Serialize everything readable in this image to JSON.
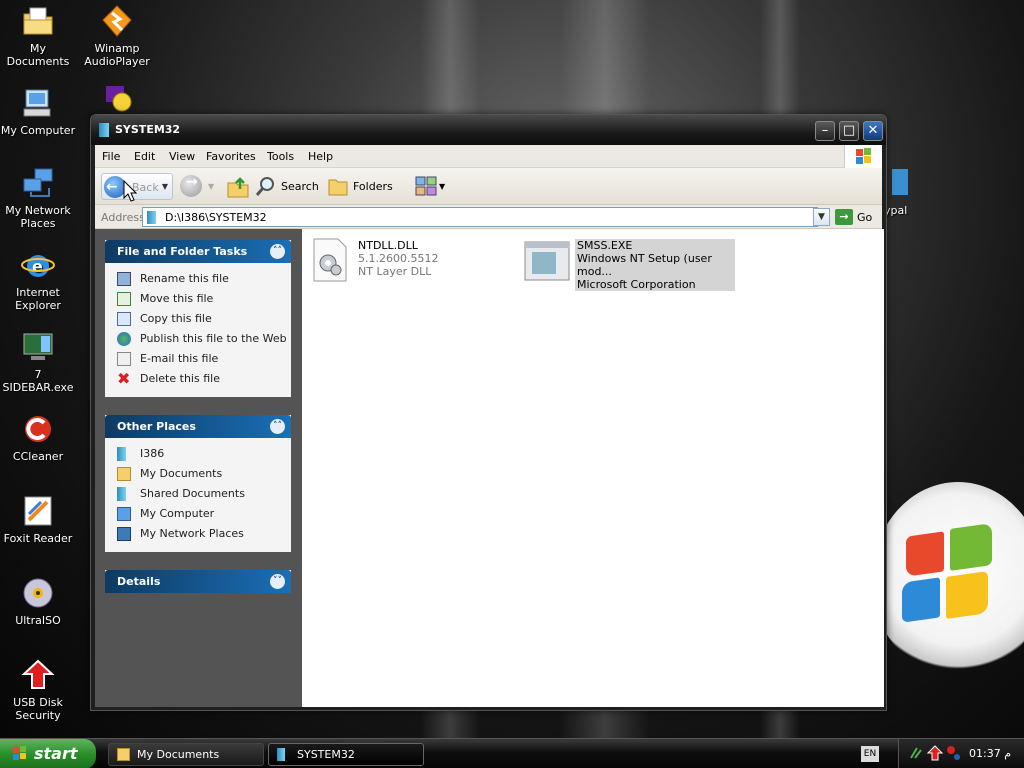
{
  "desktop": {
    "icons": [
      {
        "label": "My Documents",
        "icon": "my-documents-icon"
      },
      {
        "label": "Winamp AudioPlayer",
        "icon": "winamp-icon"
      },
      {
        "label": "My Computer",
        "icon": "my-computer-icon"
      },
      {
        "label": "My Network Places",
        "icon": "network-places-icon"
      },
      {
        "label": "Internet Explorer",
        "icon": "internet-explorer-icon"
      },
      {
        "label": "7 SIDEBAR.exe",
        "icon": "sidebar-icon"
      },
      {
        "label": "CCleaner",
        "icon": "ccleaner-icon"
      },
      {
        "label": "Foxit Reader",
        "icon": "foxit-icon"
      },
      {
        "label": "UltraISO",
        "icon": "ultraiso-icon"
      },
      {
        "label": "USB Disk Security",
        "icon": "usb-disk-security-icon"
      },
      {
        "label": "ypal",
        "icon": "partial-icon"
      }
    ]
  },
  "window": {
    "title": "SYSTEM32",
    "menu": [
      "File",
      "Edit",
      "View",
      "Favorites",
      "Tools",
      "Help"
    ],
    "toolbar": {
      "back": "Back",
      "search": "Search",
      "folders": "Folders"
    },
    "address": {
      "label": "Address",
      "path": "D:\\I386\\SYSTEM32",
      "go": "Go"
    }
  },
  "tasks_panel": {
    "title": "File and Folder Tasks",
    "items": [
      "Rename this file",
      "Move this file",
      "Copy this file",
      "Publish this file to the Web",
      "E-mail this file",
      "Delete this file"
    ]
  },
  "places_panel": {
    "title": "Other Places",
    "items": [
      "I386",
      "My Documents",
      "Shared Documents",
      "My Computer",
      "My Network Places"
    ]
  },
  "details_panel": {
    "title": "Details"
  },
  "files": [
    {
      "name": "NTDLL.DLL",
      "line2": "5.1.2600.5512",
      "line3": "NT Layer DLL",
      "selected": false
    },
    {
      "name": "SMSS.EXE",
      "line2": "Windows NT Setup (user mod...",
      "line3": "Microsoft Corporation",
      "selected": true
    }
  ],
  "taskbar": {
    "start": "start",
    "items": [
      "My Documents",
      "SYSTEM32"
    ],
    "language": "EN",
    "clock": "01:37  م"
  },
  "colors": {
    "panel_header": "#1a6fb6",
    "start_green": "#2a8f2a",
    "selection": "#d4d4d4"
  }
}
